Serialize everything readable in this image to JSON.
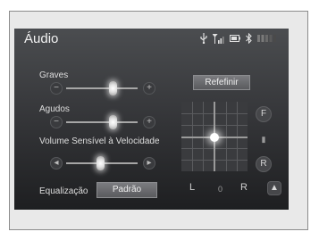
{
  "header": {
    "title": "Áudio"
  },
  "status_icons": [
    "usb-icon",
    "signal-icon",
    "battery-icon",
    "bluetooth-icon",
    "level-meter-icon"
  ],
  "bass": {
    "label": "Graves",
    "minus_icon": "minus-icon",
    "plus_icon": "plus-icon",
    "level": 0.6
  },
  "treble": {
    "label": "Agudos",
    "minus_icon": "minus-icon",
    "plus_icon": "plus-icon",
    "level": 0.6
  },
  "svc": {
    "label": "Volume Sensível à Velocidade",
    "minus_icon": "speaker-minus-icon",
    "plus_icon": "speaker-plus-icon",
    "level": 0.5
  },
  "reset_label": "Refefinir",
  "fader": {
    "front": "F",
    "rear": "R",
    "left": "L",
    "right": "R",
    "balance_value": "0"
  },
  "equalizer": {
    "label": "Equalização",
    "value": "Padrão"
  },
  "colors": {
    "screen_top": "#4b4d50",
    "screen_bottom": "#1e1f21",
    "knob_glow": "#ffffff"
  }
}
